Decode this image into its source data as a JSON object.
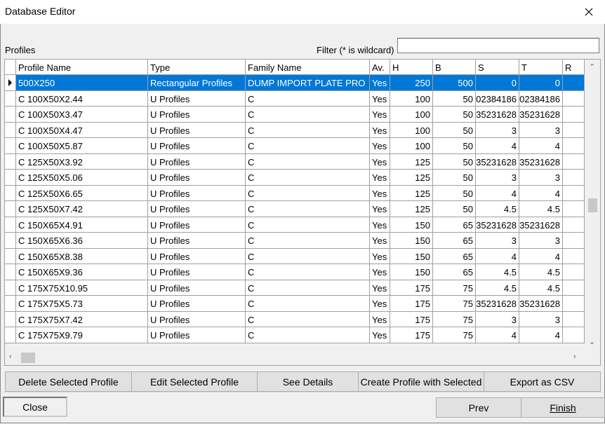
{
  "window": {
    "title": "Database Editor"
  },
  "labels": {
    "profiles": "Profiles",
    "filter": "Filter (* is wildcard)"
  },
  "filter": {
    "value": ""
  },
  "columns": [
    "Profile Name",
    "Type",
    "Family Name",
    "Av.",
    "H",
    "B",
    "S",
    "T",
    "R"
  ],
  "rows": [
    [
      "500X250",
      "Rectangular Profiles",
      "DUMP IMPORT PLATE PRO",
      "Yes",
      "250",
      "500",
      "0",
      "0",
      ""
    ],
    [
      "C 100X50X2.44",
      "U Profiles",
      "C",
      "Yes",
      "100",
      "50",
      "02384186",
      "02384186",
      ""
    ],
    [
      "C 100X50X3.47",
      "U Profiles",
      "C",
      "Yes",
      "100",
      "50",
      "35231628",
      "35231628",
      ""
    ],
    [
      "C 100X50X4.47",
      "U Profiles",
      "C",
      "Yes",
      "100",
      "50",
      "3",
      "3",
      ""
    ],
    [
      "C 100X50X5.87",
      "U Profiles",
      "C",
      "Yes",
      "100",
      "50",
      "4",
      "4",
      ""
    ],
    [
      "C 125X50X3.92",
      "U Profiles",
      "C",
      "Yes",
      "125",
      "50",
      "35231628",
      "35231628",
      ""
    ],
    [
      "C 125X50X5.06",
      "U Profiles",
      "C",
      "Yes",
      "125",
      "50",
      "3",
      "3",
      ""
    ],
    [
      "C 125X50X6.65",
      "U Profiles",
      "C",
      "Yes",
      "125",
      "50",
      "4",
      "4",
      ""
    ],
    [
      "C 125X50X7.42",
      "U Profiles",
      "C",
      "Yes",
      "125",
      "50",
      "4.5",
      "4.5",
      ""
    ],
    [
      "C 150X65X4.91",
      "U Profiles",
      "C",
      "Yes",
      "150",
      "65",
      "35231628",
      "35231628",
      ""
    ],
    [
      "C 150X65X6.36",
      "U Profiles",
      "C",
      "Yes",
      "150",
      "65",
      "3",
      "3",
      ""
    ],
    [
      "C 150X65X8.38",
      "U Profiles",
      "C",
      "Yes",
      "150",
      "65",
      "4",
      "4",
      ""
    ],
    [
      "C 150X65X9.36",
      "U Profiles",
      "C",
      "Yes",
      "150",
      "65",
      "4.5",
      "4.5",
      ""
    ],
    [
      "C 175X75X10.95",
      "U Profiles",
      "C",
      "Yes",
      "175",
      "75",
      "4.5",
      "4.5",
      ""
    ],
    [
      "C 175X75X5.73",
      "U Profiles",
      "C",
      "Yes",
      "175",
      "75",
      "35231628",
      "35231628",
      ""
    ],
    [
      "C 175X75X7.42",
      "U Profiles",
      "C",
      "Yes",
      "175",
      "75",
      "3",
      "3",
      ""
    ],
    [
      "C 175X75X9.79",
      "U Profiles",
      "C",
      "Yes",
      "175",
      "75",
      "4",
      "4",
      ""
    ]
  ],
  "selected_row": 0,
  "actions": {
    "delete": "Delete Selected Profile",
    "edit": "Edit Selected Profile",
    "details": "See Details",
    "create": "Create Profile with Selected",
    "export": "Export as CSV"
  },
  "footer": {
    "close": "Close",
    "prev": "Prev",
    "finish": "Finish"
  },
  "colors": {
    "selection": "#0078d7",
    "background": "#f0f0f0"
  }
}
